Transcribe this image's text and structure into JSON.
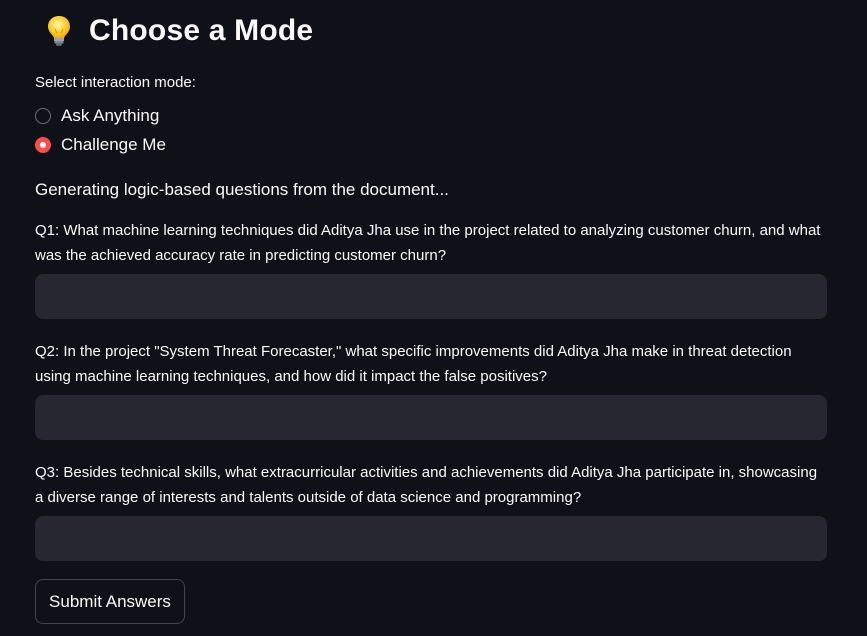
{
  "header": {
    "title": "Choose a Mode",
    "icon": "lightbulb-icon"
  },
  "mode_select": {
    "label": "Select interaction mode:",
    "options": [
      {
        "label": "Ask Anything",
        "selected": false
      },
      {
        "label": "Challenge Me",
        "selected": true
      }
    ],
    "accent_color": "#ff4b4b"
  },
  "status_text": "Generating logic-based questions from the document...",
  "questions": [
    {
      "text": "Q1: What machine learning techniques did Aditya Jha use in the project related to analyzing customer churn, and what was the achieved accuracy rate in predicting customer churn?",
      "answer": ""
    },
    {
      "text": "Q2: In the project \"System Threat Forecaster,\" what specific improvements did Aditya Jha make in threat detection using machine learning techniques, and how did it impact the false positives?",
      "answer": ""
    },
    {
      "text": "Q3: Besides technical skills, what extracurricular activities and achievements did Aditya Jha participate in, showcasing a diverse range of interests and talents outside of data science and programming?",
      "answer": ""
    }
  ],
  "submit_label": "Submit Answers",
  "colors": {
    "background": "#0e1117",
    "input_background": "#262730",
    "text": "#fafafa"
  }
}
